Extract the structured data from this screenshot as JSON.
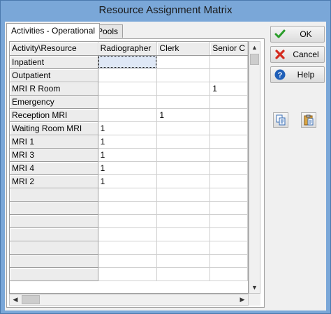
{
  "window": {
    "title": "Resource Assignment Matrix"
  },
  "tabs": [
    {
      "label": "Activities - Operational",
      "active": true
    },
    {
      "label": "Pools",
      "active": false
    }
  ],
  "grid": {
    "corner_label": "Activity\\Resource",
    "columns": [
      "Radiographer",
      "Clerk",
      "Senior C"
    ],
    "rows": [
      {
        "label": "Inpatient",
        "cells": [
          "",
          "",
          ""
        ]
      },
      {
        "label": "Outpatient",
        "cells": [
          "",
          "",
          ""
        ]
      },
      {
        "label": "MRI R Room",
        "cells": [
          "",
          "",
          "1"
        ]
      },
      {
        "label": "Emergency",
        "cells": [
          "",
          "",
          ""
        ]
      },
      {
        "label": "Reception MRI",
        "cells": [
          "",
          "1",
          ""
        ]
      },
      {
        "label": "Waiting Room MRI",
        "cells": [
          "1",
          "",
          ""
        ]
      },
      {
        "label": "MRI 1",
        "cells": [
          "1",
          "",
          ""
        ]
      },
      {
        "label": "MRI 3",
        "cells": [
          "1",
          "",
          ""
        ]
      },
      {
        "label": "MRI 4",
        "cells": [
          "1",
          "",
          ""
        ]
      },
      {
        "label": "MRI 2",
        "cells": [
          "1",
          "",
          ""
        ]
      },
      {
        "label": "",
        "cells": [
          "",
          "",
          ""
        ]
      },
      {
        "label": "",
        "cells": [
          "",
          "",
          ""
        ]
      },
      {
        "label": "",
        "cells": [
          "",
          "",
          ""
        ]
      },
      {
        "label": "",
        "cells": [
          "",
          "",
          ""
        ]
      },
      {
        "label": "",
        "cells": [
          "",
          "",
          ""
        ]
      },
      {
        "label": "",
        "cells": [
          "",
          "",
          ""
        ]
      },
      {
        "label": "",
        "cells": [
          "",
          "",
          ""
        ]
      }
    ]
  },
  "buttons": {
    "ok": {
      "label": "OK",
      "icon": "check-icon",
      "color": "#2a9d2a"
    },
    "cancel": {
      "label": "Cancel",
      "icon": "x-icon",
      "color": "#d42a1e"
    },
    "help": {
      "label": "Help",
      "icon": "question-icon",
      "color": "#1f5fb8"
    },
    "copy": {
      "icon": "copy-icon"
    },
    "paste": {
      "icon": "paste-icon"
    }
  }
}
